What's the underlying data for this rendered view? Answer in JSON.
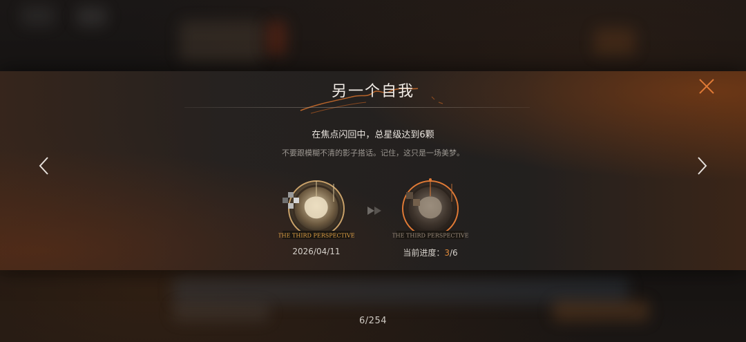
{
  "modal": {
    "title": "另一个自我",
    "condition": "在焦点闪回中，总星级达到6颗",
    "flavor": "不要跟模糊不清的影子搭话。记住，这只是一场美梦。"
  },
  "badges": {
    "left_caption": "THE THIRD PERSPECTIVE",
    "right_caption": "THE THIRD PERSPECTIVE",
    "date": "2026/04/11",
    "progress_label": "当前进度：",
    "progress_current": "3",
    "progress_total": "/6"
  },
  "pager": {
    "text": "6/254"
  },
  "icons": {
    "close": "close-icon",
    "prev": "chevron-left-icon",
    "next": "chevron-right-icon"
  },
  "colors": {
    "accent": "#e08a3a",
    "text": "#f1ece6"
  }
}
